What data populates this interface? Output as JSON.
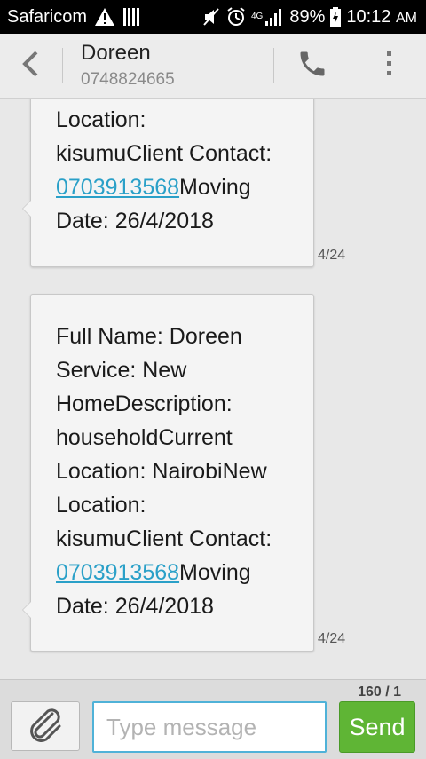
{
  "status_bar": {
    "carrier": "Safaricom",
    "network_type": "4G",
    "battery_percent": "89%",
    "time": "10:12",
    "ampm": "AM"
  },
  "header": {
    "contact_name": "Doreen",
    "contact_number": "0748824665"
  },
  "messages": [
    {
      "lines_before_link": [
        "Location:",
        "kisumuClient Contact:"
      ],
      "link": "0703913568",
      "link_suffix": "Moving",
      "lines_after_link": [
        "Date: 26/4/2018"
      ],
      "timestamp": "4/24"
    },
    {
      "lines_before_link": [
        "Full Name: Doreen",
        "Service: New",
        "HomeDescription:",
        "householdCurrent",
        "Location: NairobiNew",
        "Location:",
        "kisumuClient Contact:"
      ],
      "link": "0703913568",
      "link_suffix": "Moving",
      "lines_after_link": [
        "Date: 26/4/2018"
      ],
      "timestamp": "4/24"
    }
  ],
  "compose": {
    "char_counter": "160 / 1",
    "placeholder": "Type message",
    "send_label": "Send"
  },
  "icons": {
    "warning": "warning-icon",
    "sim": "sim-card-icon",
    "mute": "vibrate-off-icon",
    "alarm": "alarm-icon",
    "signal": "signal-icon",
    "battery": "battery-charging-icon",
    "back": "back-icon",
    "phone": "phone-icon",
    "overflow": "overflow-menu-icon",
    "attach": "paperclip-icon"
  },
  "colors": {
    "link": "#2aa0c8",
    "send_button": "#5fb535",
    "input_border": "#4fb2d8"
  }
}
